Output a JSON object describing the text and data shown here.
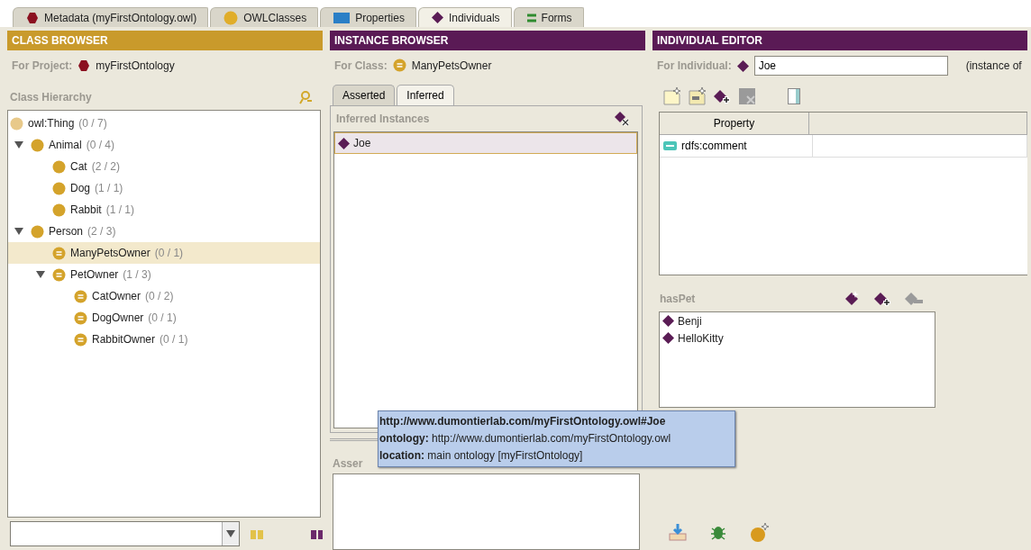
{
  "tabs": [
    {
      "label": "Metadata (myFirstOntology.owl)",
      "kind": "metadata",
      "selected": false
    },
    {
      "label": "OWLClasses",
      "kind": "classes",
      "selected": false
    },
    {
      "label": "Properties",
      "kind": "properties",
      "selected": false
    },
    {
      "label": "Individuals",
      "kind": "individuals",
      "selected": true
    },
    {
      "label": "Forms",
      "kind": "forms",
      "selected": false
    }
  ],
  "class_browser": {
    "title": "CLASS BROWSER",
    "project_label": "For Project:",
    "project": "myFirstOntology",
    "hierarchy_label": "Class Hierarchy",
    "root": {
      "name": "owl:Thing",
      "count": "(0 / 7)",
      "kind": "root",
      "selected": false,
      "children": [
        {
          "name": "Animal",
          "count": "(0 / 4)",
          "kind": "primitive",
          "selected": false,
          "expanded": true,
          "children": [
            {
              "name": "Cat",
              "count": "(2 / 2)",
              "kind": "primitive",
              "selected": false
            },
            {
              "name": "Dog",
              "count": "(1 / 1)",
              "kind": "primitive",
              "selected": false
            },
            {
              "name": "Rabbit",
              "count": "(1 / 1)",
              "kind": "primitive",
              "selected": false
            }
          ]
        },
        {
          "name": "Person",
          "count": "(2 / 3)",
          "kind": "primitive",
          "selected": false,
          "expanded": true,
          "children": [
            {
              "name": "ManyPetsOwner",
              "count": "(0 / 1)",
              "kind": "defined",
              "selected": true
            },
            {
              "name": "PetOwner",
              "count": "(1 / 3)",
              "kind": "defined",
              "selected": false,
              "expanded": true,
              "children": [
                {
                  "name": "CatOwner",
                  "count": "(0 / 2)",
                  "kind": "defined",
                  "selected": false
                },
                {
                  "name": "DogOwner",
                  "count": "(0 / 1)",
                  "kind": "defined",
                  "selected": false
                },
                {
                  "name": "RabbitOwner",
                  "count": "(0 / 1)",
                  "kind": "defined",
                  "selected": false
                }
              ]
            }
          ]
        }
      ]
    }
  },
  "instance_browser": {
    "title": "INSTANCE BROWSER",
    "class_label": "For Class:",
    "class_name": "ManyPetsOwner",
    "tabs": [
      {
        "label": "Asserted",
        "selected": false
      },
      {
        "label": "Inferred",
        "selected": true
      }
    ],
    "list_title": "Inferred Instances",
    "instances": [
      {
        "name": "Joe",
        "selected": true
      }
    ],
    "types_title": "Asser"
  },
  "individual_editor": {
    "title": "INDIVIDUAL EDITOR",
    "individual_label": "For Individual:",
    "individual": "Joe",
    "instance_of": "(instance of",
    "table": {
      "columns": [
        "Property"
      ],
      "rows": [
        {
          "property": "rdfs:comment"
        }
      ]
    },
    "has_pet_title": "hasPet",
    "pets": [
      "Benji",
      "HelloKitty"
    ]
  },
  "tooltip": {
    "uri": "http://www.dumontierlab.com/myFirstOntology.owl#Joe",
    "ontology": "**ontology:** http://www.dumontierlab.com/myFirstOntology.owl",
    "location": "**location:** main ontology [myFirstOntology]"
  }
}
